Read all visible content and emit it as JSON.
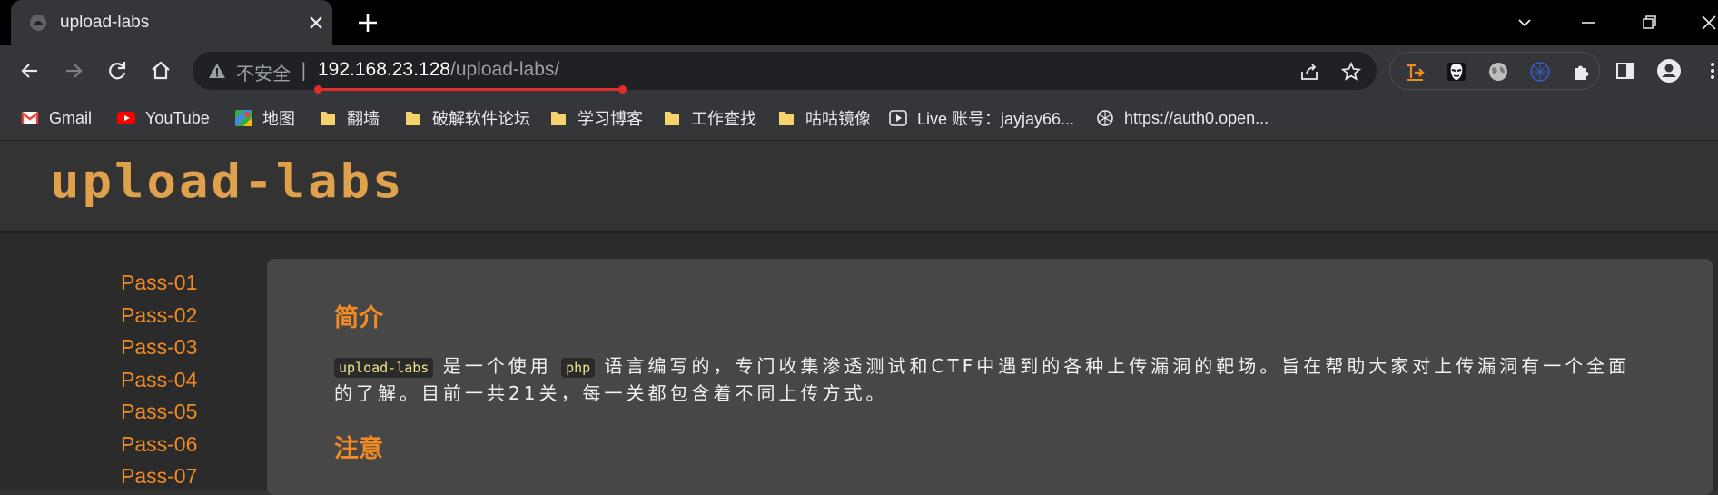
{
  "browser": {
    "tab_title": "upload-labs",
    "address": {
      "security_label": "不安全",
      "separator": "|",
      "host": "192.168.23.128",
      "path": "/upload-labs/"
    },
    "bookmarks": [
      {
        "label": "Gmail",
        "icon": "gmail-icon"
      },
      {
        "label": "YouTube",
        "icon": "youtube-icon"
      },
      {
        "label": "地图",
        "icon": "maps-icon"
      },
      {
        "label": "翻墙",
        "icon": "folder-icon"
      },
      {
        "label": "破解软件论坛",
        "icon": "folder-icon"
      },
      {
        "label": "学习博客",
        "icon": "folder-icon"
      },
      {
        "label": "工作查找",
        "icon": "folder-icon"
      },
      {
        "label": "咕咕镜像",
        "icon": "folder-icon"
      },
      {
        "label": "Live 账号：jayjay66...",
        "icon": "play-icon"
      },
      {
        "label": "https://auth0.open...",
        "icon": "openai-icon"
      }
    ]
  },
  "page": {
    "logo": "upload-labs",
    "sidebar": [
      "Pass-01",
      "Pass-02",
      "Pass-03",
      "Pass-04",
      "Pass-05",
      "Pass-06",
      "Pass-07"
    ],
    "intro": {
      "heading": "简介",
      "code1": "upload-labs",
      "text1": "是一个使用",
      "code2": "php",
      "text2": "语言编写的，专门收集渗透测试和CTF中遇到的各种上传漏洞的靶场。旨在帮助大家对上传漏洞有一个全面的了解。目前一共21关，每一关都包含着不同上传方式。"
    },
    "notice": {
      "heading": "注意"
    }
  },
  "colors": {
    "accent": "#f08a24",
    "logo": "#dfa14b",
    "card_bg": "#474747",
    "page_bg": "#2b2b2b",
    "url_underline": "#e22b2b"
  }
}
